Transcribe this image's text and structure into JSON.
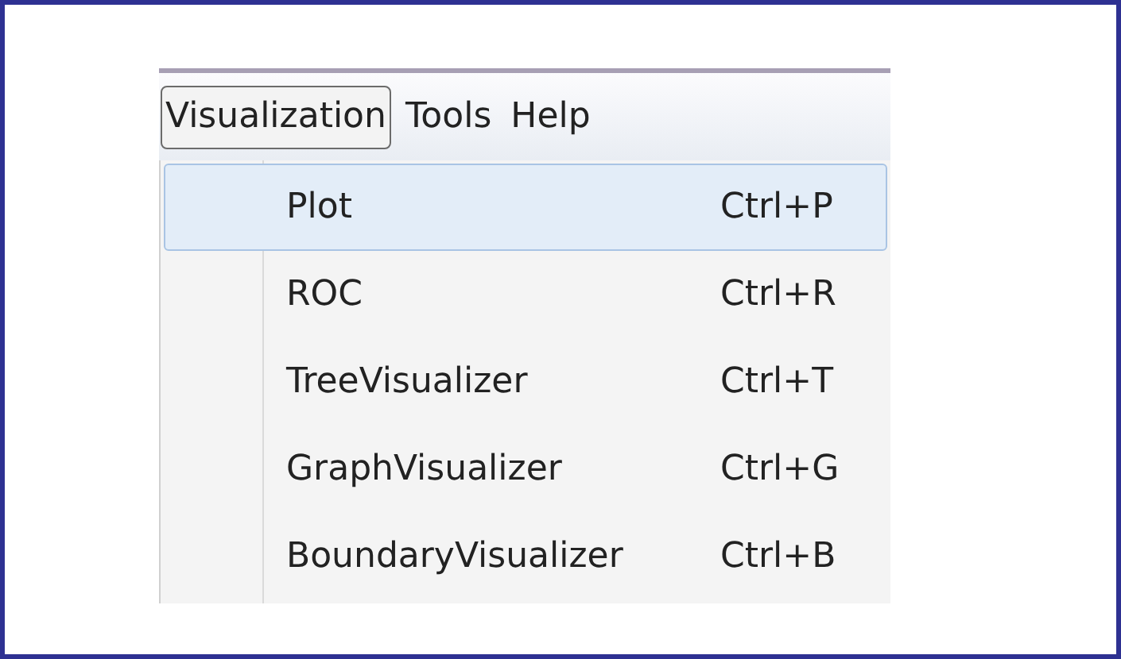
{
  "menu_bar": [
    {
      "label": "Visualization",
      "selected": true
    },
    {
      "label": "Tools",
      "selected": false
    },
    {
      "label": "Help",
      "selected": false
    }
  ],
  "menu_items": [
    {
      "label": "Plot",
      "shortcut": "Ctrl+P",
      "selected": true
    },
    {
      "label": "ROC",
      "shortcut": "Ctrl+R",
      "selected": false
    },
    {
      "label": "TreeVisualizer",
      "shortcut": "Ctrl+T",
      "selected": false
    },
    {
      "label": "GraphVisualizer",
      "shortcut": "Ctrl+G",
      "selected": false
    },
    {
      "label": "BoundaryVisualizer",
      "shortcut": "Ctrl+B",
      "selected": false
    }
  ]
}
